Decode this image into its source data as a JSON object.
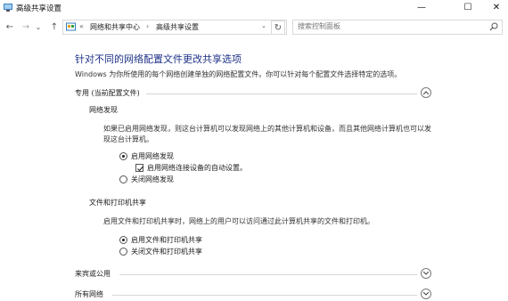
{
  "window": {
    "title": "高级共享设置",
    "minimize_glyph": "—",
    "maximize_glyph": "☐",
    "close_glyph": "✕"
  },
  "nav": {
    "back_glyph": "←",
    "forward_glyph": "→",
    "recent_glyph": "⌄",
    "up_glyph": "↑",
    "address_sep": "«",
    "breadcrumb": [
      "网络和共享中心",
      "高级共享设置"
    ],
    "breadcrumb_sep": "›",
    "address_dropdown_glyph": "⌄",
    "refresh_glyph": "↻",
    "search_placeholder": "搜索控制面板"
  },
  "main": {
    "title": "针对不同的网络配置文件更改共享选项",
    "description": "Windows 为你所使用的每个网络创建单独的网络配置文件。你可以针对每个配置文件选择特定的选项。",
    "sections": [
      {
        "label": "专用 (当前配置文件)",
        "expanded": true,
        "groups": [
          {
            "title": "网络发现",
            "description": "如果已启用网络发现，则这台计算机可以发现网络上的其他计算机和设备，而且其他网络计算机也可以发现这台计算机。",
            "options": [
              {
                "label": "启用网络发现",
                "checked": true
              },
              {
                "label": "关闭网络发现",
                "checked": false
              }
            ],
            "sub_checkbox": {
              "label": "启用网络连接设备的自动设置。",
              "checked": true
            }
          },
          {
            "title": "文件和打印机共享",
            "description": "启用文件和打印机共享时，网络上的用户可以访问通过此计算机共享的文件和打印机。",
            "options": [
              {
                "label": "启用文件和打印机共享",
                "checked": true
              },
              {
                "label": "关闭文件和打印机共享",
                "checked": false
              }
            ]
          }
        ]
      },
      {
        "label": "来宾或公用",
        "expanded": false
      },
      {
        "label": "所有网络",
        "expanded": false
      }
    ]
  },
  "icons": {
    "app": "network-share-icon",
    "address": "control-panel-icon",
    "search": "search-icon",
    "chevron_up": "chevron-up-icon",
    "chevron_down": "chevron-down-icon",
    "check": "checkmark-icon"
  },
  "colors": {
    "title_blue": "#1e3287",
    "divider": "#d6d6d6"
  }
}
